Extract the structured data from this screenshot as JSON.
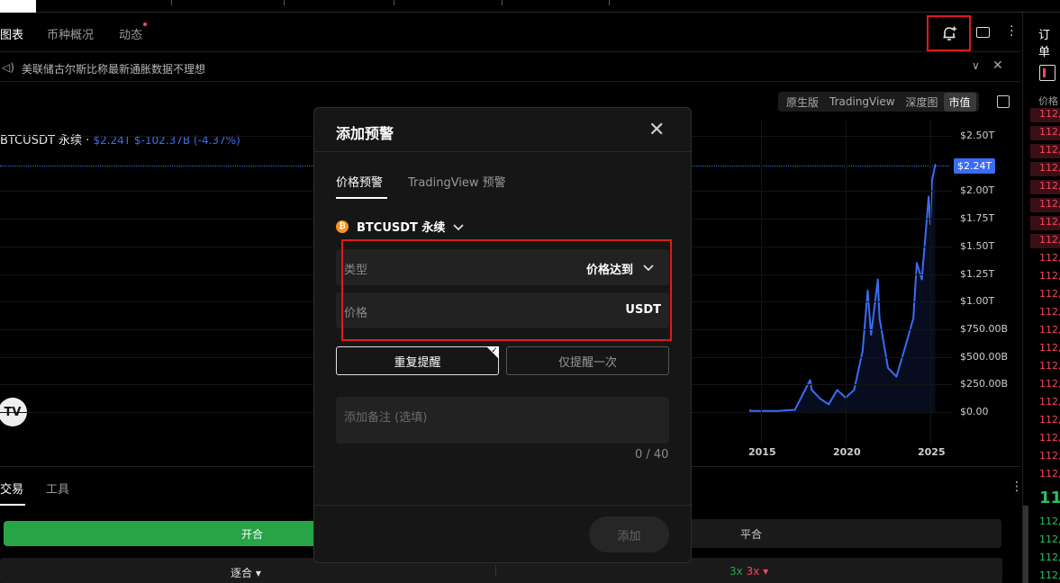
{
  "header": {
    "tabs": [
      {
        "label": "图表",
        "active": true
      },
      {
        "label": "币种概况",
        "active": false
      },
      {
        "label": "动态",
        "active": false,
        "dot": true
      }
    ],
    "icons": [
      "add-alert-bell-icon",
      "window-icon",
      "more-vertical-icon"
    ]
  },
  "news": {
    "text": "美联储古尔斯比称最新通胀数据不理想",
    "icons": [
      "speaker-icon",
      "chevron-down-icon",
      "close-icon"
    ]
  },
  "view_switch": {
    "options": [
      "原生版",
      "TradingView",
      "深度图",
      "市值"
    ],
    "selected": "市值"
  },
  "symbol": {
    "name": "BTCUSDT 永续 ·",
    "stats": "$2.24T  $-102.37B (-4.37%)"
  },
  "chart_data": {
    "type": "line",
    "title": "",
    "x": [
      2013.5,
      2014,
      2015,
      2016,
      2017,
      2017.9,
      2018,
      2018.5,
      2019,
      2019.5,
      2020,
      2020.5,
      2021,
      2021.3,
      2021.5,
      2021.9,
      2022,
      2022.5,
      2023,
      2023.5,
      2024,
      2024.2,
      2024.5,
      2024.9,
      2025,
      2025.1,
      2025.3
    ],
    "values": [
      0.02,
      0.01,
      0.01,
      0.01,
      0.02,
      0.29,
      0.2,
      0.12,
      0.07,
      0.2,
      0.13,
      0.2,
      0.55,
      1.1,
      0.7,
      1.2,
      0.85,
      0.4,
      0.32,
      0.58,
      0.85,
      1.35,
      1.2,
      1.95,
      1.7,
      2.1,
      2.24
    ],
    "ylim": [
      0,
      2.5
    ],
    "yticks": [
      "$2.50T",
      "$2.24T",
      "$2.00T",
      "$1.75T",
      "$1.50T",
      "$1.25T",
      "$1.00T",
      "$750.00B",
      "$500.00B",
      "$250.00B",
      "$0.00"
    ],
    "xticks": [
      "2015",
      "2020",
      "2025"
    ],
    "last_price_label": "$2.24T",
    "line_color": "#3b6cf6"
  },
  "trade": {
    "tabs": [
      "交易",
      "工具"
    ],
    "open_label": "开合",
    "close_label": "平合",
    "margin_mode": "逐合 ▾",
    "leverage_long": "3x",
    "leverage_short": "3x ▾"
  },
  "book": {
    "title": "订单",
    "header": "价格",
    "asks": [
      "112,",
      "112,",
      "112,",
      "112,",
      "112,",
      "112,",
      "112,",
      "112,",
      "112,",
      "112,",
      "112,",
      "112,",
      "112,",
      "112,",
      "112,",
      "112,",
      "112,",
      "112,",
      "112,",
      "112,",
      "112,"
    ],
    "mid": "11",
    "bids": [
      "112,",
      "112,",
      "112,",
      "112,",
      "112,"
    ]
  },
  "modal": {
    "title": "添加预警",
    "tabs": [
      {
        "label": "价格预警",
        "active": true
      },
      {
        "label": "TradingView 预警",
        "active": false
      }
    ],
    "symbol": "BTCUSDT 永续",
    "type_label": "类型",
    "type_value": "价格达到",
    "price_label": "价格",
    "price_unit": "USDT",
    "repeat_label": "重复提醒",
    "once_label": "仅提醒一次",
    "note_placeholder": "添加备注 (选填)",
    "counter": "0 / 40",
    "add_label": "添加"
  }
}
